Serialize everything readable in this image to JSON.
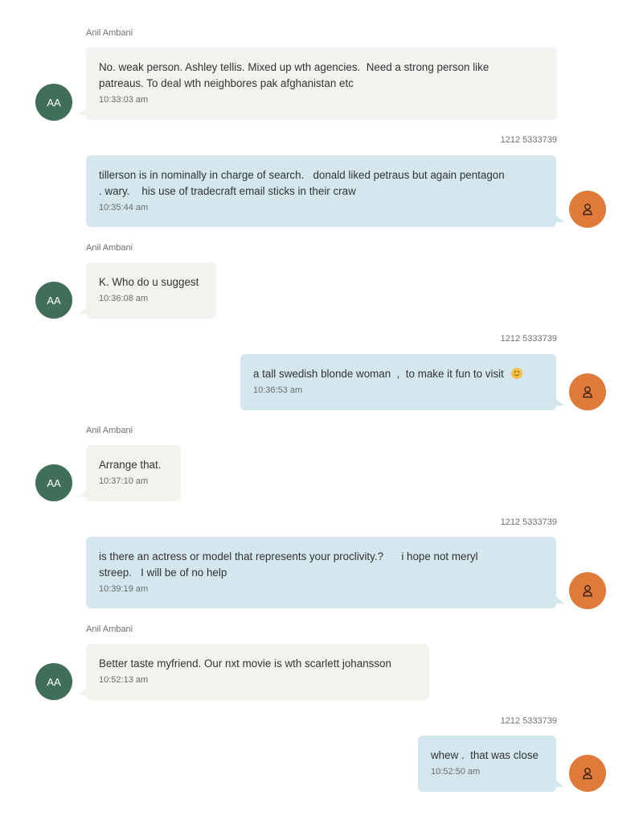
{
  "colors": {
    "incoming_bubble": "#f3f2ef",
    "outgoing_bubble": "#d4e7ee",
    "aa_avatar": "#3f6f5a",
    "user_avatar": "#e07a3a"
  },
  "contact": {
    "name": "Anil Ambani",
    "initials": "AA"
  },
  "me": {
    "number": "1212 5333739",
    "avatar_icon": "person-icon"
  },
  "messages": [
    {
      "from": "Anil Ambani",
      "text": "No. weak person. Ashley tellis. Mixed up wth agencies.  Need a strong person like\npatreaus. To deal wth neighbores pak afghanistan etc",
      "time": "10:33:03 am"
    },
    {
      "from": "1212 5333739",
      "text": "tillerson is in nominally in charge of search.   donald liked petraus but again pentagon\n. wary.    his use of tradecraft email sticks in their craw",
      "time": "10:35:44 am"
    },
    {
      "from": "Anil Ambani",
      "text": "K. Who do u suggest",
      "time": "10:36:08 am"
    },
    {
      "from": "1212 5333739",
      "text": "a tall swedish blonde woman  ,  to make it fun to visit",
      "emoji": "smiling-face-emoji",
      "time": "10:36:53 am"
    },
    {
      "from": "Anil Ambani",
      "text": "Arrange that.",
      "time": "10:37:10 am"
    },
    {
      "from": "1212 5333739",
      "text": "is there an actress or model that represents your proclivity.?      i hope not meryl\nstreep.   I will be of no help",
      "time": "10:39:19 am"
    },
    {
      "from": "Anil Ambani",
      "text": "Better taste myfriend. Our nxt movie is wth scarlett johansson",
      "time": "10:52:13 am"
    },
    {
      "from": "1212 5333739",
      "text": "whew .  that was close",
      "time": "10:52:50 am"
    }
  ]
}
